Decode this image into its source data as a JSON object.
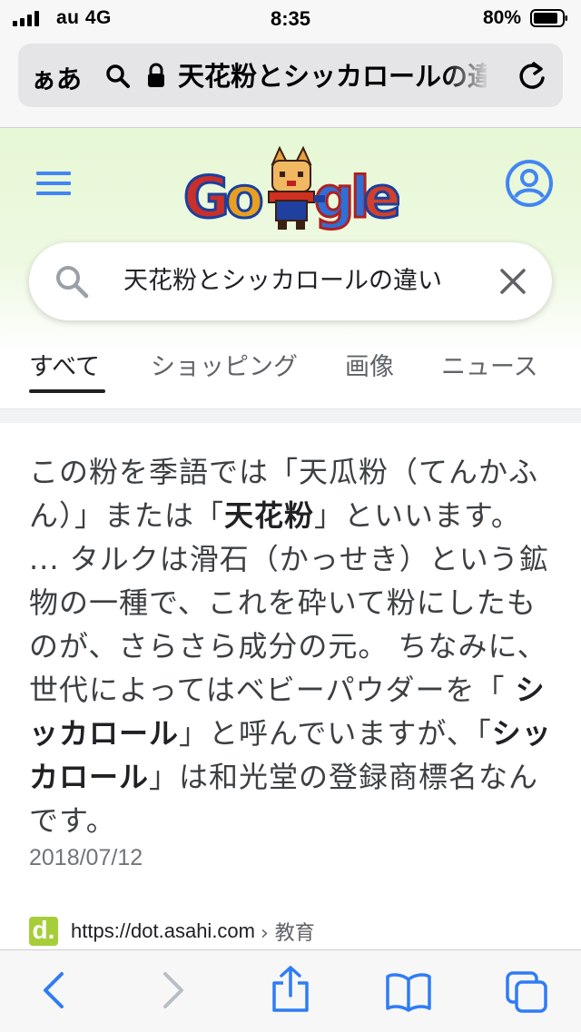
{
  "status_bar": {
    "carrier": "au  4G",
    "time": "8:35",
    "battery": "80%"
  },
  "address_bar": {
    "aa_label": "ぁあ",
    "url": "天花粉とシッカロールの違い"
  },
  "search": {
    "query": "天花粉とシッカロールの違い"
  },
  "tabs": [
    {
      "label": "すべて",
      "active": true
    },
    {
      "label": "ショッピング"
    },
    {
      "label": "画像"
    },
    {
      "label": "ニュース"
    }
  ],
  "result": {
    "snippet": [
      {
        "t": "この粉を季語では「天瓜粉（てんかふん）」または「"
      },
      {
        "t": "天花粉",
        "b": true
      },
      {
        "t": "」といいます。 ... タルクは滑石（かっせき）という鉱物の一種で、これを砕いて粉にしたものが、さらさら成分の元。 ちなみに、世代によってはベビーパウダーを「 "
      },
      {
        "t": "シッカロール",
        "b": true
      },
      {
        "t": "」と呼んでいますが、「"
      },
      {
        "t": "シッカロール",
        "b": true
      },
      {
        "t": "」は和光堂の登録商標名なんです。"
      }
    ],
    "date": "2018/07/12",
    "favicon_letter": "d.",
    "source_url": "https://dot.asahi.com",
    "source_path": "› 教育"
  },
  "colors": {
    "google_blue": "#4285f4",
    "header_tint": "#e6f8d4",
    "favicon_green": "#a6ce39",
    "safari_blue": "#2f7cf6"
  },
  "icons": [
    "menu-icon",
    "account-icon",
    "search-icon",
    "close-icon",
    "lock-icon",
    "reload-icon",
    "back-icon",
    "forward-icon",
    "share-icon",
    "bookmarks-icon",
    "tabs-icon"
  ]
}
